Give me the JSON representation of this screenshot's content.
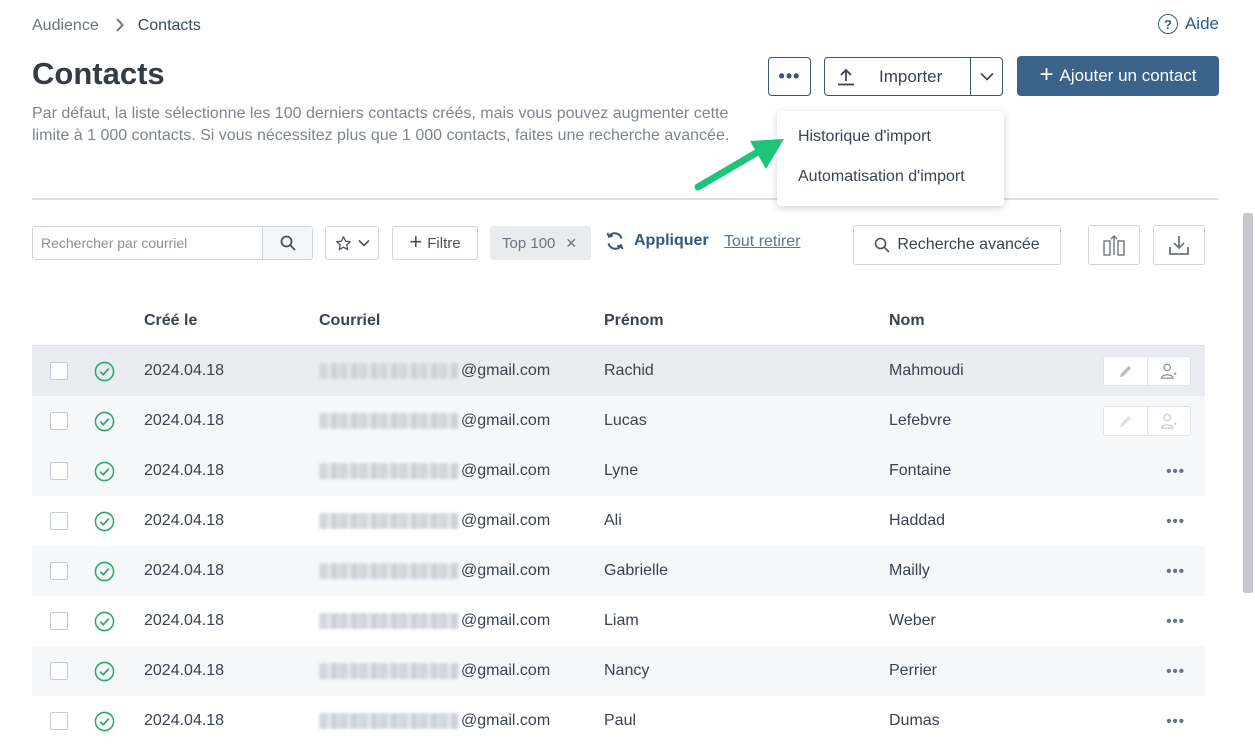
{
  "breadcrumb": {
    "parent": "Audience",
    "separator": ">",
    "current": "Contacts"
  },
  "help": {
    "label": "Aide",
    "icon": "question-circle-icon"
  },
  "page": {
    "title": "Contacts",
    "description": "Par défaut, la liste sélectionne les 100 derniers contacts créés, mais vous pouvez augmenter cette limite à 1 000 contacts. Si vous nécessitez plus que 1 000 contacts, faites une recherche avancée."
  },
  "toolbar": {
    "more_label": "•••",
    "import_label": "Importer",
    "add_label": "Ajouter un contact"
  },
  "import_menu": {
    "items": [
      {
        "label": "Historique d'import"
      },
      {
        "label": "Automatisation d'import"
      }
    ]
  },
  "filters": {
    "search_placeholder": "Rechercher par courriel",
    "filter_label": "Filtre",
    "chip_label": "Top 100",
    "apply_label": "Appliquer",
    "remove_all_label": "Tout retirer",
    "advanced_search_label": "Recherche avancée"
  },
  "table": {
    "columns": {
      "created": "Créé le",
      "email": "Courriel",
      "first_name": "Prénom",
      "last_name": "Nom"
    },
    "rows": [
      {
        "created": "2024.04.18",
        "email_domain": "@gmail.com",
        "first_name": "Rachid",
        "last_name": "Mahmoudi"
      },
      {
        "created": "2024.04.18",
        "email_domain": "@gmail.com",
        "first_name": "Lucas",
        "last_name": "Lefebvre"
      },
      {
        "created": "2024.04.18",
        "email_domain": "@gmail.com",
        "first_name": "Lyne",
        "last_name": "Fontaine"
      },
      {
        "created": "2024.04.18",
        "email_domain": "@gmail.com",
        "first_name": "Ali",
        "last_name": "Haddad"
      },
      {
        "created": "2024.04.18",
        "email_domain": "@gmail.com",
        "first_name": "Gabrielle",
        "last_name": "Mailly"
      },
      {
        "created": "2024.04.18",
        "email_domain": "@gmail.com",
        "first_name": "Liam",
        "last_name": "Weber"
      },
      {
        "created": "2024.04.18",
        "email_domain": "@gmail.com",
        "first_name": "Nancy",
        "last_name": "Perrier"
      },
      {
        "created": "2024.04.18",
        "email_domain": "@gmail.com",
        "first_name": "Paul",
        "last_name": "Dumas"
      }
    ],
    "row_more_label": "•••"
  },
  "colors": {
    "primary": "#3b6289",
    "accent_green": "#1fb86b",
    "status_green": "#2aa866",
    "arrow_green": "#1ec47a"
  }
}
